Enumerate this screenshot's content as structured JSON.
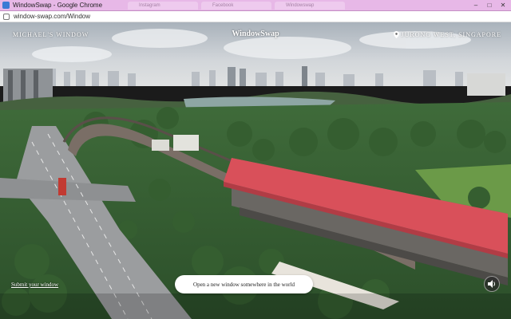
{
  "browser": {
    "window_title": "WindowSwap - Google Chrome",
    "url": "window-swap.com/Window",
    "ghost_tab_labels": [
      "Instagram",
      "Facebook",
      "Windowswap"
    ],
    "controls": {
      "minimize": "–",
      "maximize": "□",
      "close": "✕"
    }
  },
  "overlay": {
    "room_name": "MICHAEL'S WINDOW",
    "logo": "WindowSwap",
    "location": "JURONG WEST, SINGAPORE",
    "submit_link": "Submit your window",
    "open_button": "Open a new window somewhere in the world",
    "sound_icon": "speaker-icon"
  },
  "colors": {
    "titlebar": "#e7b8e7",
    "station_roof": "#d9505a",
    "lake": "#8aa3a3",
    "sky": "#c6ccd2"
  }
}
